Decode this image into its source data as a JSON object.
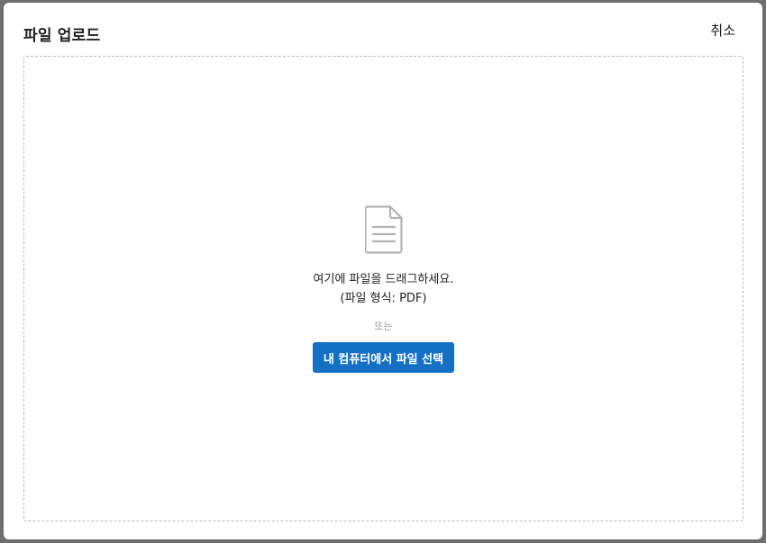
{
  "dialog": {
    "title": "파일 업로드",
    "cancel_label": "취소"
  },
  "dropzone": {
    "icon": "document-icon",
    "instruction": "여기에 파일을 드래그하세요.",
    "format_hint": "(파일 형식: PDF)",
    "or_text": "또는",
    "select_button_label": "내 컴퓨터에서 파일 선택"
  },
  "colors": {
    "button_bg": "#1370c5",
    "dashed_border": "#bdbdbd",
    "icon": "#b3b3b3"
  }
}
